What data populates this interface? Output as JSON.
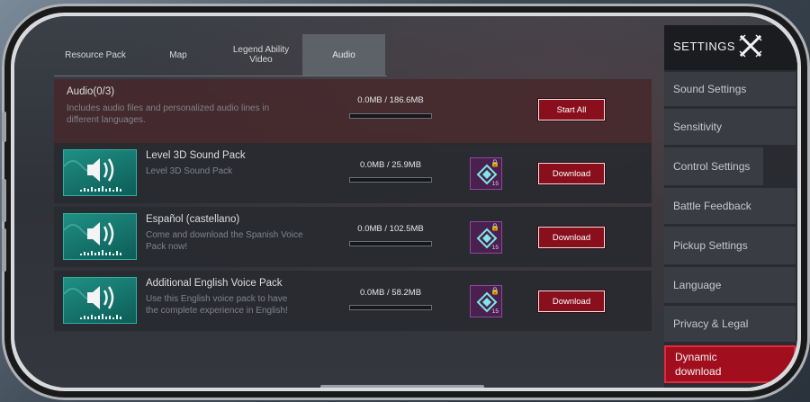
{
  "tabs": [
    {
      "label": "Resource Pack"
    },
    {
      "label": "Map"
    },
    {
      "label": "Legend Ability Video"
    },
    {
      "label": "Audio"
    }
  ],
  "summary": {
    "title": "Audio(0/3)",
    "description": "Includes audio files and personalized audio lines in different languages.",
    "size": "0.0MB / 186.6MB",
    "progress": 0,
    "button": "Start All"
  },
  "packs": [
    {
      "title": "Level 3D Sound Pack",
      "description": "Level 3D Sound Pack",
      "size": "0.0MB / 25.9MB",
      "progress": 0,
      "badge_count": "15",
      "button": "Download"
    },
    {
      "title": "Español (castellano)",
      "description": "Come and download the Spanish Voice Pack now!",
      "size": "0.0MB / 102.5MB",
      "progress": 0,
      "badge_count": "15",
      "button": "Download"
    },
    {
      "title": "Additional English Voice Pack",
      "description": "Use this English voice pack to have the complete experience in English!",
      "size": "0.0MB / 58.2MB",
      "progress": 0,
      "badge_count": "15",
      "button": "Download"
    }
  ],
  "sidebar": {
    "title": "SETTINGS",
    "close_icon": "x-close-icon",
    "items": [
      {
        "label": "Sound Settings"
      },
      {
        "label": "Sensitivity"
      },
      {
        "label": "Control Settings"
      },
      {
        "label": "Battle Feedback"
      },
      {
        "label": "Pickup Settings"
      },
      {
        "label": "Language"
      },
      {
        "label": "Privacy & Legal"
      },
      {
        "label": "Dynamic download",
        "active": true
      }
    ]
  },
  "colors": {
    "accent": "#a10f1e",
    "teal": "#1f8f84",
    "badge": "#4a2050"
  }
}
